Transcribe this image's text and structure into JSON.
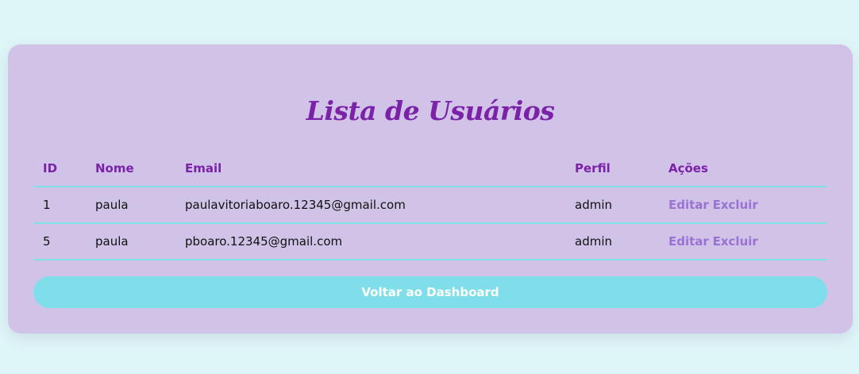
{
  "page": {
    "title": "Lista de Usuários"
  },
  "table": {
    "headers": {
      "id": "ID",
      "nome": "Nome",
      "email": "Email",
      "perfil": "Perfil",
      "acoes": "Ações"
    },
    "rows": [
      {
        "id": "1",
        "nome": "paula",
        "email": "paulavitoriaboaro.12345@gmail.com",
        "perfil": "admin",
        "edit_label": "Editar",
        "delete_label": "Excluir"
      },
      {
        "id": "5",
        "nome": "paula",
        "email": "pboaro.12345@gmail.com",
        "perfil": "admin",
        "edit_label": "Editar",
        "delete_label": "Excluir"
      }
    ]
  },
  "back_button": {
    "label": "Voltar ao Dashboard"
  },
  "colors": {
    "background": "#dff6f8",
    "card": "#d0c3e7",
    "accent_purple": "#7b22a8",
    "link_purple": "#9a72d4",
    "accent_cyan": "#7fdeea"
  }
}
